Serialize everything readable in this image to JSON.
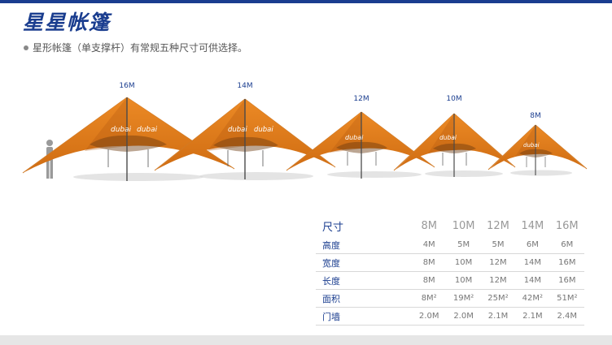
{
  "page": {
    "title": "星星帐篷",
    "subtitle": "星形帐篷（单支撑杆）有常规五种尺寸可供选择。"
  },
  "tents": [
    {
      "size_label": "16M",
      "brand": "dubai"
    },
    {
      "size_label": "14M",
      "brand": "dubai"
    },
    {
      "size_label": "12M",
      "brand": "dubai"
    },
    {
      "size_label": "10M",
      "brand": "dubai"
    },
    {
      "size_label": "8M",
      "brand": "dubai"
    }
  ],
  "spec_table": {
    "header": {
      "label": "尺寸",
      "sizes": [
        "8M",
        "10M",
        "12M",
        "14M",
        "16M"
      ]
    },
    "rows": [
      {
        "label": "高度",
        "values": [
          "4M",
          "5M",
          "5M",
          "6M",
          "6M"
        ]
      },
      {
        "label": "宽度",
        "values": [
          "8M",
          "10M",
          "12M",
          "14M",
          "16M"
        ]
      },
      {
        "label": "长度",
        "values": [
          "8M",
          "10M",
          "12M",
          "14M",
          "16M"
        ]
      },
      {
        "label": "面积",
        "values": [
          "8M²",
          "19M²",
          "25M²",
          "42M²",
          "51M²"
        ]
      },
      {
        "label": "门墙",
        "values": [
          "2.0M",
          "2.0M",
          "2.1M",
          "2.1M",
          "2.4M"
        ]
      }
    ]
  },
  "colors": {
    "accent": "#1a3d8f",
    "tent": "#e07b1d",
    "tent_dark": "#b85d10"
  },
  "icons": {
    "person": "human-scale-icon",
    "bullet": "bullet-dot-icon"
  }
}
